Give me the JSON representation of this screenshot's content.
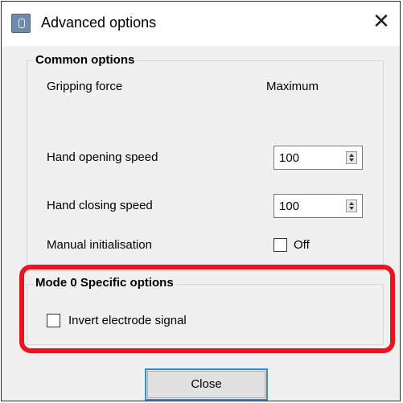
{
  "window": {
    "title": "Advanced options",
    "icon": "app-icon",
    "close_glyph": "✕"
  },
  "common_options": {
    "title": "Common options",
    "gripping_force": {
      "label": "Gripping force",
      "value": "Maximum"
    },
    "hand_opening_speed": {
      "label": "Hand opening speed",
      "value": "100"
    },
    "hand_closing_speed": {
      "label": "Hand closing speed",
      "value": "100"
    },
    "manual_initialisation": {
      "label": "Manual initialisation",
      "checkbox_label": "Off",
      "checked": false
    }
  },
  "mode_options": {
    "title": "Mode 0 Specific options",
    "invert_signal": {
      "label": "Invert electrode signal",
      "checked": false
    }
  },
  "footer": {
    "close_label": "Close"
  },
  "colors": {
    "highlight": "#e8161f",
    "button_focus": "#3b8ad8",
    "dialog_bg": "#f0f0f0"
  }
}
